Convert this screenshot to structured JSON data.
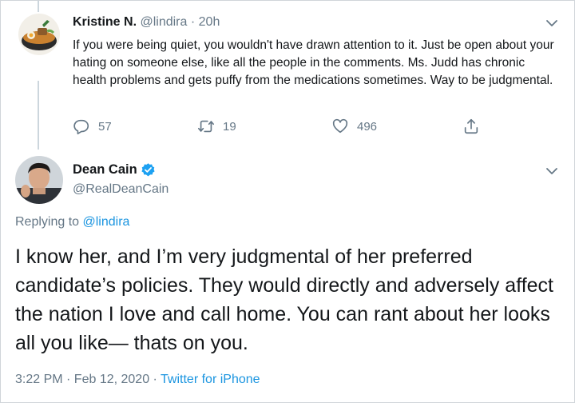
{
  "parent_tweet": {
    "author_name": "Kristine N.",
    "handle": "@lindira",
    "separator": "·",
    "time": "20h",
    "text": "If you were being quiet, you wouldn't have drawn attention to it. Just be open about your hating on someone else, like all the people in the comments. Ms. Judd has chronic health problems and gets puffy from the medications sometimes. Way to be judgmental.",
    "actions": {
      "replies": "57",
      "retweets": "19",
      "likes": "496"
    }
  },
  "main_tweet": {
    "author_name": "Dean Cain",
    "handle": "@RealDeanCain",
    "replying_label": "Replying to",
    "replying_to": "@lindira",
    "text": "I know her, and I’m very judgmental of her preferred candidate’s policies.  They would directly and adversely affect the nation I love and call home.  You can rant about her looks all you like— thats on you.",
    "timestamp": "3:22 PM · Feb 12, 2020 ·",
    "source": "Twitter for iPhone"
  },
  "colors": {
    "text": "#14171a",
    "secondary": "#657786",
    "link": "#1b95e0",
    "verified": "#1da1f2"
  },
  "icons": [
    "reply-icon",
    "retweet-icon",
    "like-icon",
    "share-icon",
    "chevron-down-icon",
    "verified-badge-icon"
  ]
}
